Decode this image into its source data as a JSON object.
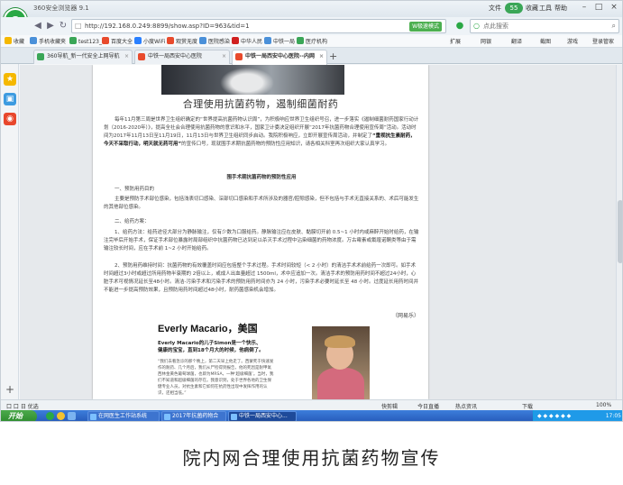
{
  "window": {
    "title": "360安全浏览器 9.1",
    "badge": "55",
    "menu": [
      "文件",
      "收藏",
      "工具",
      "帮助"
    ],
    "controls": [
      "–",
      "□",
      "×"
    ]
  },
  "address": {
    "url": "http://192.168.0.249:8899/show.asp?ID=963&tid=1",
    "mode_label": "W极速模式",
    "search_placeholder": "点此搜索"
  },
  "bookmarks": {
    "left": [
      {
        "label": "收藏",
        "color": "#f5b800"
      },
      {
        "label": "手机收藏夹",
        "color": "#4a90d9"
      },
      {
        "label": "test123_",
        "color": "#3aa657"
      },
      {
        "label": "百度大全",
        "color": "#e84a2c"
      },
      {
        "label": "小度WiFi",
        "color": "#2a80ff"
      },
      {
        "label": "观赏无度",
        "color": "#e84a2c"
      },
      {
        "label": "医院感染",
        "color": "#4a90d9"
      },
      {
        "label": "中华人民",
        "color": "#d02020"
      },
      {
        "label": "中铁一局",
        "color": "#4a90d9"
      },
      {
        "label": "医疗机构",
        "color": "#3aa657"
      }
    ],
    "right": [
      "扩展",
      "网银",
      "翻译",
      "截图",
      "游戏",
      "登录管家"
    ]
  },
  "tabs": [
    {
      "label": "360导航_新一代安全上网导航",
      "active": false
    },
    {
      "label": "中铁一局西安中心医院",
      "active": false
    },
    {
      "label": "中铁一局西安中心医院--内网",
      "active": true
    }
  ],
  "new_tab": "+",
  "article": {
    "title": "合理使用抗菌药物，遏制细菌耐药",
    "p1": "每年11月第三周是世界卫生组织确定的“世界提高抗菌药物认识周”，为积极响应世界卫生组织号召，进一步落实《遏制细菌耐药国家行动计划（2016-2020年）》，提高全社会合理使用抗菌药物的意识和水平，国家卫计委决定组织开展“2017年抗菌药物合理使用宣传周”活动。活动时间为2017年11月13日至11月19日，11月13日与世界卫生组织同步启动。我院积极响应，立即开展宣传周活动，并制定了",
    "p1_strong": "“重视抗生素耐药，今天不采取行动，明天就无药可用”",
    "p1_tail": "的宣传口号，现就围手术期抗菌药物的预防性应用知识，请各相关科室再次组织大家认真学习。",
    "section_title": "围手术期抗菌药物的预防性应用",
    "p2": "一、预防用药目的",
    "p3": "主要是预防手术部位感染，包括浅表切口感染、深部切口感染和手术所涉及的器官/腔隙感染，但不包括与手术无直接关系的、术后可能发生的其他部位感染。",
    "p4": "二、给药方案：",
    "p5": "1、给药方法：给药途径大部分为静脉输注，仅有少数为口服给药。静脉输注应在皮肤、黏膜切开前 0.5~1 小时内或麻醉开始时给药，在输注完毕后开始手术，保证手术部位暴露时局部组织中抗菌药物已达到足以杀灭手术过程中沾染细菌的药物浓度。万古霉素或氟喹诺酮类等由于需输注较长时间，应在手术前 1~2 小时开始给药。",
    "p6": "2、预防用药维持时间：抗菌药物的有效覆盖时间应包括整个手术过程。手术时间较短（< 2 小时）的清洁手术术前给药一次即可。如手术时间超过3小时或超过所用药物半衰期的 2倍以上，或成人出血量超过 1500ml，术中应追加一次。清洁手术的预防用药时间不超过24小时，心脏手术可视情况延长至48小时。清洁-污染手术和污染手术的预防用药时间亦为 24 小时，污染手术必要时延长至 48 小时。过度延长用药时间并不能进一步提高预防效果，且预防用药时间超过48小时，耐药菌感染机会增加。",
    "source": "（网易乐）"
  },
  "profile": {
    "heading": "Everly Macario，美国",
    "subtitle": "Everly Macario的儿子Simon是一个快乐、健康的宝宝，直到18个月大的时候，他病倒了。",
    "body": "“我们去看急诊的那个晚上，第二天早上他走了。西蒙死于快速发作的耐药、几个月后，我们从尸检得到报告，他的死因是耐甲氧西林金黄色葡萄球菌，也即为MRSA，一种‘超级细菌’。当时，我们不知道和超级细菌的存在。我意识到，处于世界各地的卫生保健专业人员，对抗生素和它如何在抗药性出现中发挥作用的认识，还相当低。”"
  },
  "status": {
    "left": "口 口 日 优选",
    "items": [
      "快剪辑",
      "今日直播",
      "热点资讯",
      "下载",
      "100%"
    ]
  },
  "taskbar": {
    "start": "开始",
    "tasks": [
      {
        "label": "在网医生工作站系统",
        "active": false
      },
      {
        "label": "2017年抗菌药物合",
        "active": false
      },
      {
        "label": "中铁一局西安中心...",
        "active": true
      }
    ],
    "clock": "17:05"
  },
  "caption": "院内网合理使用抗菌药物宣传"
}
